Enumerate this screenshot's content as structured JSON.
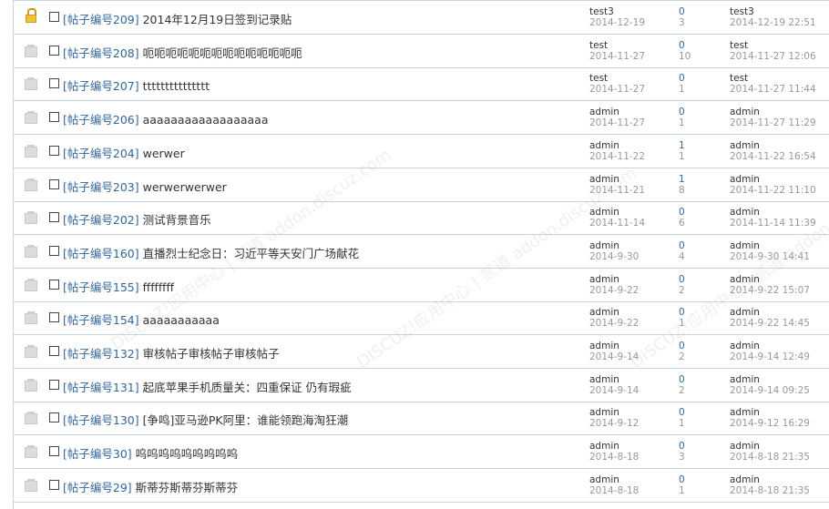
{
  "rows": [
    {
      "icon": "lock-icon",
      "num": "[帖子编号209]",
      "title": "2014年12月19日签到记录贴",
      "author": "test3",
      "date": "2014-12-19",
      "replies": "0",
      "views": "3",
      "last_user": "test3",
      "last_time": "2014-12-19 22:51"
    },
    {
      "icon": "thread-icon",
      "num": "[帖子编号208]",
      "title": "呃呃呃呃呃呃呃呃呃呃呃呃呃呃",
      "author": "test",
      "date": "2014-11-27",
      "replies": "0",
      "views": "10",
      "last_user": "test",
      "last_time": "2014-11-27 12:06"
    },
    {
      "icon": "thread-icon",
      "num": "[帖子编号207]",
      "title": "ttttttttttttttt",
      "author": "test",
      "date": "2014-11-27",
      "replies": "0",
      "views": "1",
      "last_user": "test",
      "last_time": "2014-11-27 11:44"
    },
    {
      "icon": "thread-icon",
      "num": "[帖子编号206]",
      "title": "aaaaaaaaaaaaaaaaaa",
      "author": "admin",
      "date": "2014-11-27",
      "replies": "0",
      "views": "1",
      "last_user": "admin",
      "last_time": "2014-11-27 11:29"
    },
    {
      "icon": "thread-icon",
      "num": "[帖子编号204]",
      "title": "werwer",
      "author": "admin",
      "date": "2014-11-22",
      "replies": "1",
      "views": "1",
      "last_user": "admin",
      "last_time": "2014-11-22 16:54"
    },
    {
      "icon": "thread-icon",
      "num": "[帖子编号203]",
      "title": "werwerwerwer",
      "author": "admin",
      "date": "2014-11-21",
      "replies": "1",
      "views": "8",
      "last_user": "admin",
      "last_time": "2014-11-22 11:10"
    },
    {
      "icon": "thread-icon",
      "num": "[帖子编号202]",
      "title": "测试背景音乐",
      "author": "admin",
      "date": "2014-11-14",
      "replies": "0",
      "views": "6",
      "last_user": "admin",
      "last_time": "2014-11-14 11:39"
    },
    {
      "icon": "thread-icon",
      "num": "[帖子编号160]",
      "title": "直播烈士纪念日：习近平等天安门广场献花",
      "author": "admin",
      "date": "2014-9-30",
      "replies": "0",
      "views": "4",
      "last_user": "admin",
      "last_time": "2014-9-30 14:41"
    },
    {
      "icon": "thread-icon",
      "num": "[帖子编号155]",
      "title": "ffffffff",
      "author": "admin",
      "date": "2014-9-22",
      "replies": "0",
      "views": "2",
      "last_user": "admin",
      "last_time": "2014-9-22 15:07"
    },
    {
      "icon": "thread-icon",
      "num": "[帖子编号154]",
      "title": "aaaaaaaaaaa",
      "author": "admin",
      "date": "2014-9-22",
      "replies": "0",
      "views": "1",
      "last_user": "admin",
      "last_time": "2014-9-22 14:45"
    },
    {
      "icon": "thread-icon",
      "num": "[帖子编号132]",
      "title": "审核帖子审核帖子审核帖子",
      "author": "admin",
      "date": "2014-9-14",
      "replies": "0",
      "views": "2",
      "last_user": "admin",
      "last_time": "2014-9-14 12:49"
    },
    {
      "icon": "thread-icon",
      "num": "[帖子编号131]",
      "title": "起底苹果手机质量关：四重保证 仍有瑕疵",
      "author": "admin",
      "date": "2014-9-14",
      "replies": "0",
      "views": "2",
      "last_user": "admin",
      "last_time": "2014-9-14 09:25"
    },
    {
      "icon": "thread-icon",
      "num": "[帖子编号130]",
      "title": "[争鸣]亚马逊PK阿里：谁能领跑海淘狂潮",
      "author": "admin",
      "date": "2014-9-12",
      "replies": "0",
      "views": "1",
      "last_user": "admin",
      "last_time": "2014-9-12 16:29"
    },
    {
      "icon": "thread-icon",
      "num": "[帖子编号30]",
      "title": "呜呜呜呜呜呜呜呜呜",
      "author": "admin",
      "date": "2014-8-18",
      "replies": "0",
      "views": "3",
      "last_user": "admin",
      "last_time": "2014-8-18 21:35"
    },
    {
      "icon": "thread-icon",
      "num": "[帖子编号29]",
      "title": "斯蒂芬斯蒂芬斯蒂芬",
      "author": "admin",
      "date": "2014-8-18",
      "replies": "0",
      "views": "1",
      "last_user": "admin",
      "last_time": "2014-8-18 21:35"
    }
  ],
  "watermark": "DISCUZ!应用中心 | 贰道 addon.discuz.com"
}
